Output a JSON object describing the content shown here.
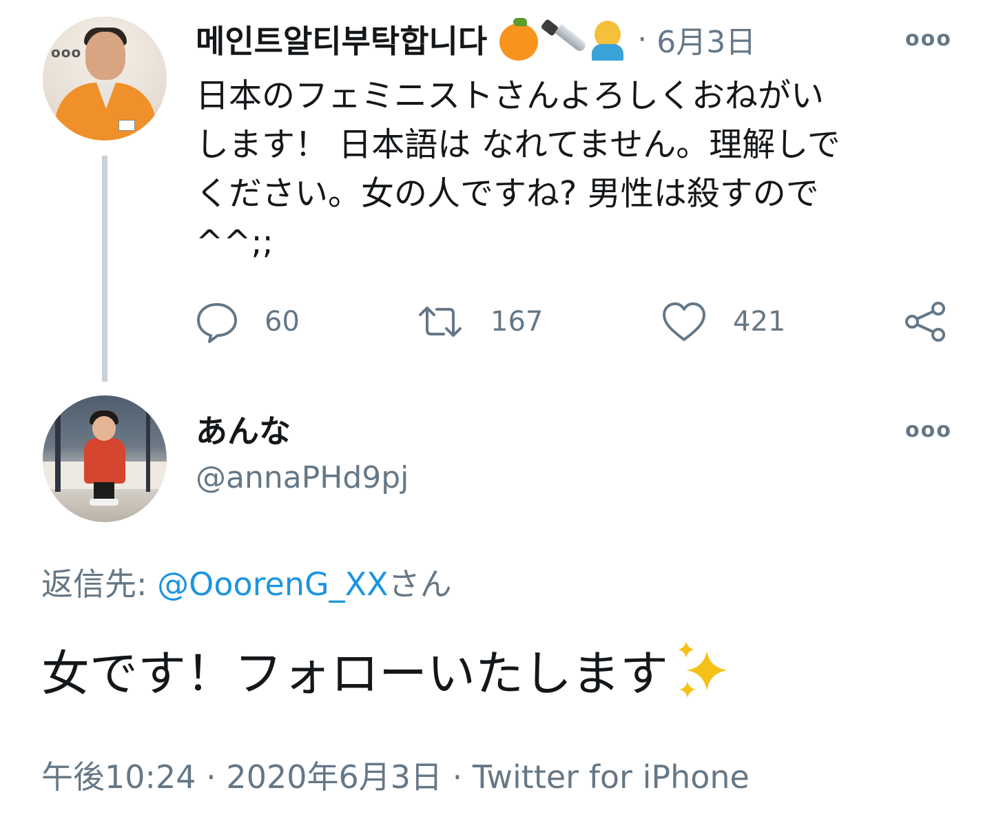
{
  "parent_tweet": {
    "display_name": "메인트알티부탁합니다",
    "name_emojis": [
      "orange-icon",
      "knife-icon",
      "facepalm-icon"
    ],
    "separator": "·",
    "date": "6月3日",
    "text": "日本のフェミニストさんよろしくおねがい\nします！ 日本語は なれてません。理解しで\nください。女の人ですね? 男性は殺すので\n^^;;",
    "actions": {
      "reply_count": "60",
      "retweet_count": "167",
      "like_count": "421"
    }
  },
  "reply_tweet": {
    "display_name": "あんな",
    "handle": "@annaPHd9pj",
    "reply_to_label": "返信先: ",
    "reply_to_mention": "@OoorenG_XX",
    "reply_to_suffix": "さん",
    "text": "女です！フォローいたします",
    "text_emoji": "sparkles-icon",
    "timestamp": "午後10:24 · 2020年6月3日 · Twitter for iPhone"
  },
  "colors": {
    "text_primary": "#14171a",
    "text_secondary": "#657786",
    "link": "#1b95e0",
    "thread_line": "#c9d0d6"
  }
}
